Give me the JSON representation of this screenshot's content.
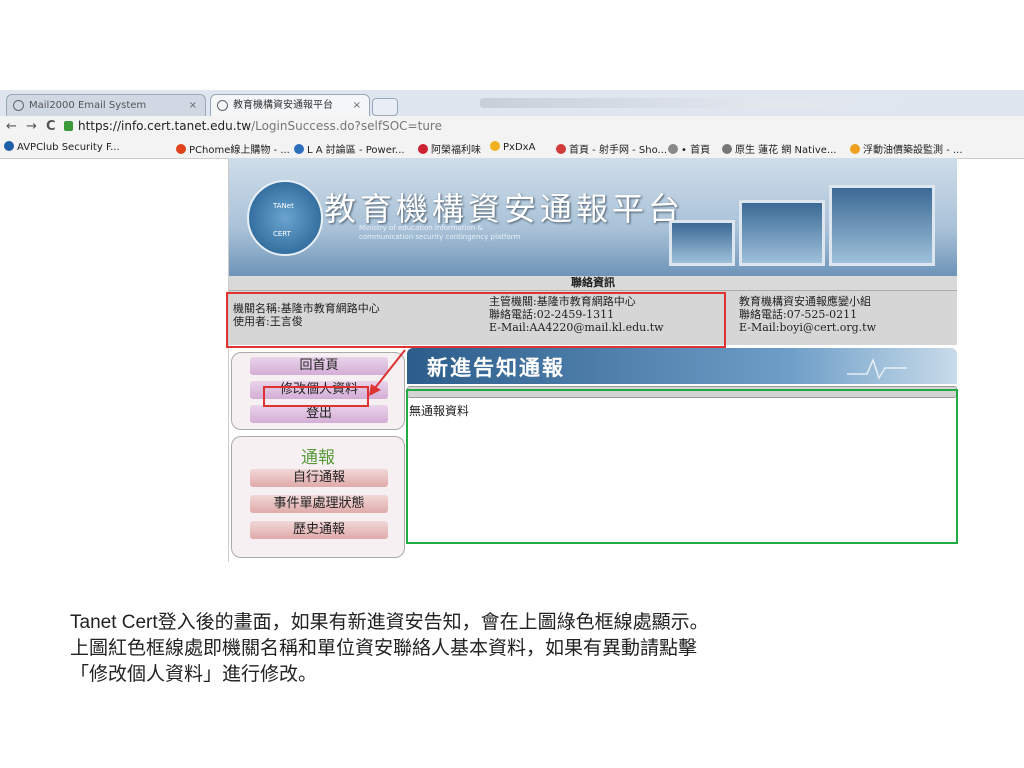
{
  "browser": {
    "tabs": [
      {
        "label": "Mail2000 Email System"
      },
      {
        "label": "教育機構資安通報平台"
      }
    ],
    "close_glyph": "×",
    "back_glyph": "←",
    "forward_glyph": "→",
    "reload_glyph": "C",
    "url_host": "https://info.cert.tanet.edu.tw",
    "url_path": "/LoginSuccess.do?selfSOC=ture",
    "bookmarks": [
      {
        "label": "AVPClub Security F...",
        "color": "#1d5fa8"
      },
      {
        "label": "PChome線上購物 - ...",
        "color": "#e0421b"
      },
      {
        "label": "L A 討論區 - Power...",
        "color": "#2c6fbd"
      },
      {
        "label": "阿榮福利味",
        "color": "#cc2233"
      },
      {
        "label": "PxDxA",
        "color": "#f0b020"
      },
      {
        "label": "首頁 - 射手网 - Sho...",
        "color": "#d23b3b"
      },
      {
        "label": "• 首頁",
        "color": "#888888"
      },
      {
        "label": "原生 蓮花 網 Native...",
        "color": "#777777"
      },
      {
        "label": "浮動油價築設監測 - ...",
        "color": "#f0a020"
      }
    ]
  },
  "page": {
    "banner_title": "教育機構資安通報平台",
    "banner_sub_line1": "Ministry of education information &",
    "banner_sub_line2": "communication security contingency platform",
    "logo_top": "TANet",
    "logo_bottom": "CERT",
    "contact_heading": "聯絡資訊",
    "org": {
      "name": "機關名稱:基隆市教育網路中心",
      "user": "使用者:王言俊"
    },
    "supervisor": {
      "name": "主管機關:基隆市教育網路中心",
      "phone": "聯絡電話:02-2459-1311",
      "email": "E-Mail:AA4220@mail.kl.edu.tw"
    },
    "cert": {
      "name": "教育機構資安通報應變小組",
      "phone": "聯絡電話:07-525-0211",
      "email": "E-Mail:boyi@cert.org.tw"
    },
    "menu": {
      "home": "回首頁",
      "edit_profile": "修改個人資料",
      "logout": "登出",
      "report_title": "通報",
      "self_report": "自行通報",
      "ticket_status": "事件單處理狀態",
      "history": "歷史通報"
    },
    "content_title": "新進告知通報",
    "no_data": "無通報資料"
  },
  "caption": {
    "line1": "Tanet Cert登入後的畫面，如果有新進資安告知，會在上圖綠色框線處顯示。",
    "line2": "上圖紅色框線處即機關名稱和單位資安聯絡人基本資料，如果有異動請點擊",
    "line3": "「修改個人資料」進行修改。"
  },
  "colors": {
    "red_box": "#dd3333",
    "green_box": "#22aa44"
  }
}
